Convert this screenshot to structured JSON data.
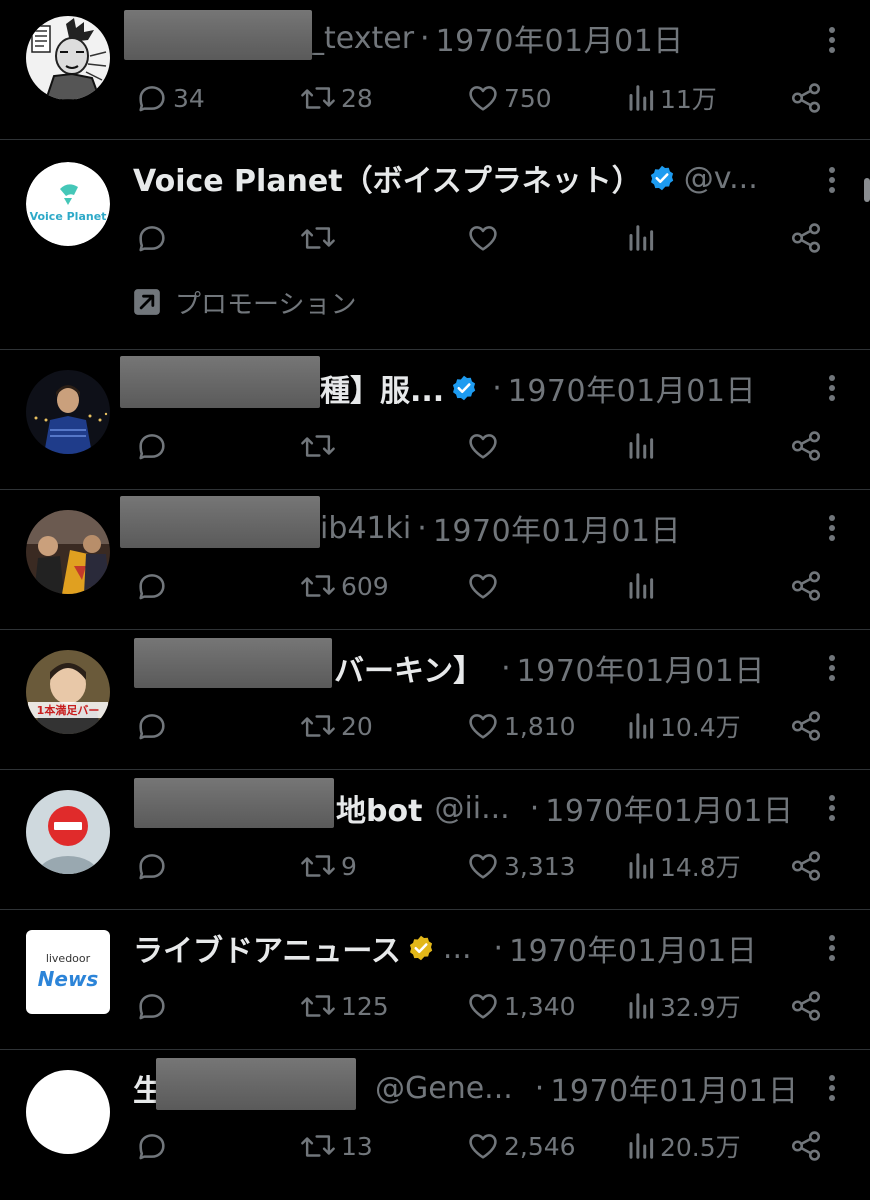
{
  "colors": {
    "background": "#000000",
    "text_primary": "#e7e9ea",
    "text_secondary": "#71767b",
    "divider": "#2f3336",
    "verified_blue": "#1d9bf0",
    "verified_gold": "#e2b719"
  },
  "icons": {
    "reply": "reply-icon",
    "retweet": "retweet-icon",
    "like": "heart-icon",
    "views": "views-chart-icon",
    "share": "share-icon",
    "more": "more-dots-icon",
    "promoted": "promoted-arrow-icon"
  },
  "tweets": [
    {
      "name_visible": "d_texter",
      "handle": "",
      "date": "1970年01月01日",
      "verified": "none",
      "replies": "34",
      "retweets": "28",
      "likes": "750",
      "views": "11万"
    },
    {
      "name_visible": "Voice Planet（ボイスプラネット）",
      "handle": "@v...",
      "date": "",
      "verified": "blue",
      "replies": "",
      "retweets": "",
      "likes": "",
      "views": "",
      "promoted_label": "プロモーション",
      "avatar_text": "Voice Planet"
    },
    {
      "name_visible": "順種】服...",
      "handle": "",
      "date": "1970年01月01日",
      "verified": "blue",
      "replies": "",
      "retweets": "",
      "likes": "",
      "views": ""
    },
    {
      "name_visible": "ib41ki",
      "handle": "",
      "date": "1970年01月01日",
      "verified": "none",
      "replies": "",
      "retweets": "609",
      "likes": "",
      "views": ""
    },
    {
      "name_visible": "バーキン】",
      "handle": "",
      "date": "1970年01月01日",
      "verified": "none",
      "replies": "",
      "retweets": "20",
      "likes": "1,810",
      "views": "10.4万",
      "avatar_text": "1本満足バー"
    },
    {
      "name_visible": "地bot",
      "handle": "@ii...",
      "date": "1970年01月01日",
      "verified": "none",
      "replies": "",
      "retweets": "9",
      "likes": "3,313",
      "views": "14.8万"
    },
    {
      "name_visible": "ライブドアニュース",
      "handle": "...",
      "date": "1970年01月01日",
      "verified": "gold",
      "replies": "",
      "retweets": "125",
      "likes": "1,340",
      "views": "32.9万",
      "avatar_text_top": "livedoor",
      "avatar_text_bottom": "News"
    },
    {
      "name_visible": "生",
      "handle": "@Gene...",
      "date": "1970年01月01日",
      "verified": "none",
      "replies": "",
      "retweets": "13",
      "likes": "2,546",
      "views": "20.5万"
    }
  ]
}
